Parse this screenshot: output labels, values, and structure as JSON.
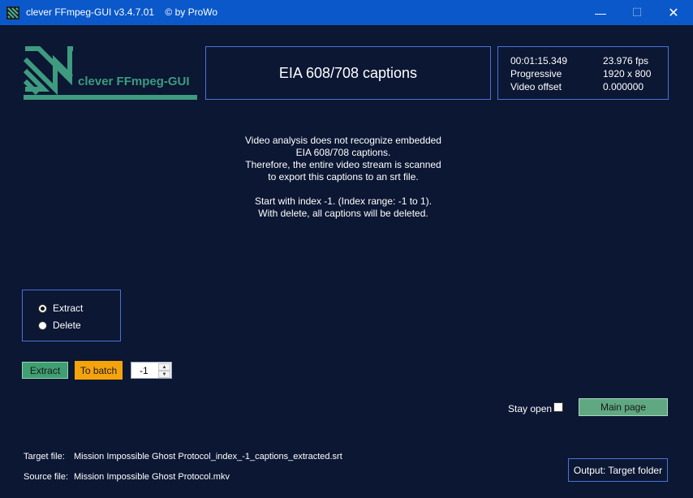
{
  "window": {
    "title": "clever FFmpeg-GUI v3.4.7.01    © by ProWo",
    "minimize": "—",
    "maximize": "☐",
    "close": "✕"
  },
  "logo": {
    "text": "clever FFmpeg-GUI"
  },
  "header": {
    "title": "EIA 608/708 captions"
  },
  "video_info": {
    "duration": "00:01:15.349",
    "fps": "23.976 fps",
    "scan": "Progressive",
    "resolution": "1920 x 800",
    "offset_label": "Video offset",
    "offset_value": "0.000000"
  },
  "message": {
    "lines": [
      "Video analysis does not recognize embedded",
      "EIA 608/708 captions.",
      "Therefore, the entire video stream is scanned",
      "to export this captions to an srt file.",
      "",
      "Start with index -1. (Index range: -1 to 1).",
      "With delete, all captions will be deleted."
    ]
  },
  "mode": {
    "options": [
      {
        "label": "Extract",
        "selected": true
      },
      {
        "label": "Delete",
        "selected": false
      }
    ]
  },
  "actions": {
    "extract_label": "Extract",
    "batch_label": "To batch",
    "index_value": "-1"
  },
  "footer": {
    "stay_open_label": "Stay open",
    "stay_open_checked": false,
    "main_page_label": "Main page",
    "target_label": "Target file:",
    "target_value": "Mission Impossible Ghost Protocol_index_-1_captions_extracted.srt",
    "source_label": "Source file:",
    "source_value": "Mission Impossible Ghost Protocol.mkv",
    "output_label": "Output: Target folder"
  },
  "colors": {
    "background": "#0b1733",
    "titlebar": "#0a58c9",
    "border": "#4c72d9",
    "extract_button": "#3f9f72",
    "batch_button": "#f5a30c",
    "main_button": "#5fa882",
    "logo_green": "#3e9b80"
  }
}
